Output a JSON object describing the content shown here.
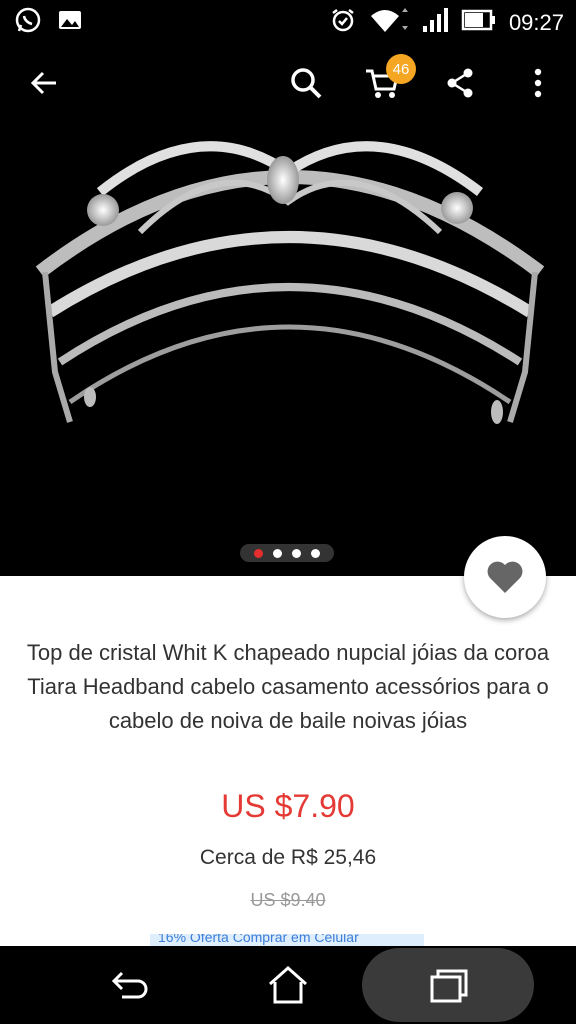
{
  "status_bar": {
    "time": "09:27",
    "left_icons": [
      "whatsapp-icon",
      "gallery-icon"
    ],
    "right_icons": [
      "alarm-icon",
      "wifi-icon",
      "signal-icon",
      "battery-icon"
    ]
  },
  "toolbar": {
    "back_icon": "back-arrow-icon",
    "search_icon": "search-icon",
    "cart_icon": "cart-icon",
    "cart_count": "46",
    "share_icon": "share-icon",
    "more_icon": "more-vert-icon"
  },
  "gallery": {
    "image": "crystal tiara product photo",
    "total_images": 4,
    "active_index": 0
  },
  "product": {
    "title": "Top de cristal Whit K chapeado nupcial jóias da coroa Tiara Headband cabelo casamento acessórios para o cabelo de noiva de baile noivas jóias",
    "price": "US $7.90",
    "approx_price": "Cerca de R$ 25,46",
    "original_price": "US $9.40",
    "promo_text": "16% Oferta Comprar em Celular"
  },
  "colors": {
    "price": "#e53935",
    "badge": "#f5a623",
    "active_dot": "#e62e2e",
    "heart": "#666666"
  },
  "nav_bar": {
    "icons": [
      "back-icon",
      "home-icon",
      "recent-apps-icon"
    ]
  }
}
